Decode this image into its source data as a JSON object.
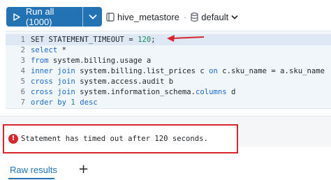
{
  "toolbar": {
    "run_label": "Run all (1000)",
    "catalog": "hive_metastore",
    "schema": "default"
  },
  "editor": {
    "lines": [
      {
        "num": "1",
        "parts": [
          [
            "SET STATEMENT_TIMEOUT = ",
            ""
          ],
          [
            "120",
            "num"
          ],
          [
            ";",
            ""
          ]
        ]
      },
      {
        "num": "2",
        "parts": [
          [
            "select",
            "kw"
          ],
          [
            " *",
            ""
          ]
        ]
      },
      {
        "num": "3",
        "parts": [
          [
            "from",
            "kw"
          ],
          [
            " system.billing.usage a",
            ""
          ]
        ]
      },
      {
        "num": "4",
        "parts": [
          [
            "inner join",
            "kw"
          ],
          [
            " system.billing.list_prices c ",
            ""
          ],
          [
            "on",
            "kw"
          ],
          [
            " c.sku_name = a.sku_name",
            ""
          ]
        ]
      },
      {
        "num": "5",
        "parts": [
          [
            "cross join",
            "kw"
          ],
          [
            " system.access.audit b",
            ""
          ]
        ]
      },
      {
        "num": "6",
        "parts": [
          [
            "cross join",
            "kw"
          ],
          [
            " system.information_schema.",
            ""
          ],
          [
            "columns",
            "kw"
          ],
          [
            " d",
            ""
          ]
        ]
      },
      {
        "num": "7",
        "parts": [
          [
            "order by",
            "kw"
          ],
          [
            " ",
            ""
          ],
          [
            "1",
            "num"
          ],
          [
            " ",
            ""
          ],
          [
            "desc",
            "kw"
          ]
        ]
      }
    ]
  },
  "error": {
    "icon": "error-icon",
    "message": "Statement has timed out after 120 seconds."
  },
  "results": {
    "tab_label": "Raw results",
    "add_label": "+"
  },
  "colors": {
    "accent": "#2272b4",
    "error": "#d7262c"
  }
}
